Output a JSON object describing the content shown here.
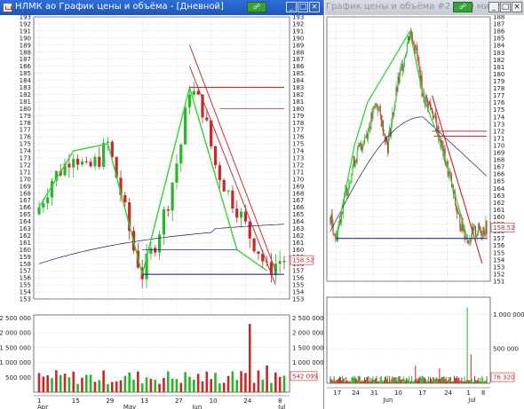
{
  "colors": {
    "up": "#2bb52b",
    "down": "#c42a2a",
    "trend": "#35d235",
    "resistance": "#c0343a",
    "support": "#2a2aa8",
    "ma": "#1c1c5c",
    "grid": "#b8b8b8",
    "volume": "#c42a2a",
    "volume_up": "#2bb52b"
  },
  "daily": {
    "title": "НЛМК ао График цены и объёма - [Дневной]",
    "link_label": "☍",
    "price_axis_ticks": [
      "193",
      "192",
      "191",
      "190",
      "189",
      "188",
      "187",
      "186",
      "185",
      "184",
      "183",
      "182",
      "181",
      "180",
      "179",
      "178",
      "177",
      "176",
      "175",
      "174",
      "173",
      "172",
      "171",
      "170",
      "169",
      "168",
      "167",
      "166",
      "165",
      "164",
      "163",
      "162",
      "161",
      "160",
      "159",
      "158",
      "157",
      "156",
      "155",
      "154",
      "153"
    ],
    "last_price": "158.52",
    "volume_axis_ticks": [
      "2 500 000",
      "2 000 000",
      "1 500 000",
      "1 000 000",
      "500 000"
    ],
    "volume_axis_ticks_right": [
      "2 500 000",
      "2 000 000",
      "1 500 000",
      "1 000 000",
      "500 000"
    ],
    "last_volume": "542 099",
    "date_ticks": [
      "1",
      "15",
      "29",
      "13",
      "27",
      "10",
      "24",
      "8"
    ],
    "month_labels": [
      "Apr",
      "May",
      "Jun",
      "Jul"
    ]
  },
  "hourly": {
    "title": "График цены и объёма #2 - [60 минут]",
    "link_label": "☍",
    "price_axis_ticks": [
      "188",
      "187",
      "186",
      "185",
      "184",
      "183",
      "182",
      "181",
      "180",
      "179",
      "178",
      "177",
      "176",
      "175",
      "174",
      "173",
      "172",
      "171",
      "170",
      "169",
      "168",
      "167",
      "166",
      "165",
      "164",
      "163",
      "162",
      "161",
      "160",
      "159",
      "158",
      "157",
      "156",
      "155",
      "154",
      "153",
      "152",
      "151"
    ],
    "last_price": "158.52",
    "volume_axis_ticks": [
      "1 000 000",
      "500 000"
    ],
    "last_volume": "76 320",
    "date_ticks": [
      "17",
      "24",
      "31",
      "10",
      "17",
      "24",
      "1",
      "8"
    ],
    "month_labels": [
      "Jun",
      "Jul"
    ]
  },
  "chart_data": [
    {
      "type": "candlestick",
      "title": "НЛМК ао График цены и объёма - [Дневной]",
      "ylim": [
        153,
        193
      ],
      "x": [
        "Apr 1",
        "Apr 15",
        "Apr 29",
        "May 13",
        "May 27",
        "Jun 10",
        "Jun 24",
        "Jul 8"
      ],
      "close": [
        166,
        172,
        174,
        157,
        168,
        183,
        170,
        158.52
      ],
      "trend_lines": [
        {
          "role": "zigzag",
          "points": [
            [
              0,
              166
            ],
            [
              8,
              174
            ],
            [
              16,
              175
            ],
            [
              24,
              156.5
            ],
            [
              35,
              183
            ],
            [
              46,
              160
            ],
            [
              53,
              157
            ]
          ]
        },
        {
          "role": "support",
          "y": 156.5
        },
        {
          "role": "resistance",
          "y": 183
        },
        {
          "role": "resistance",
          "y": 180
        },
        {
          "role": "support",
          "y": 160
        }
      ],
      "moving_average": "smooth line rising from ~158 to ~164",
      "volume_ylim": [
        0,
        2500000
      ],
      "volume_peak": 2300000
    },
    {
      "type": "candlestick",
      "title": "График цены и объёма #2 - [60 минут]",
      "ylim": [
        151,
        188
      ],
      "x": [
        "Jun 17",
        "Jun 24",
        "Jun 31",
        "Jul 10",
        "Jul 17",
        "Jul 24",
        "Jul 1",
        "Jul 8"
      ],
      "close": [
        158,
        168,
        176,
        186,
        175,
        170,
        159,
        158.52
      ],
      "trend_lines": [
        {
          "role": "resistance",
          "y": 171.5
        },
        {
          "role": "resistance",
          "y": 172
        },
        {
          "role": "support",
          "y": 157
        }
      ],
      "volume_ylim": [
        0,
        1200000
      ],
      "volume_peak": 1100000
    }
  ]
}
